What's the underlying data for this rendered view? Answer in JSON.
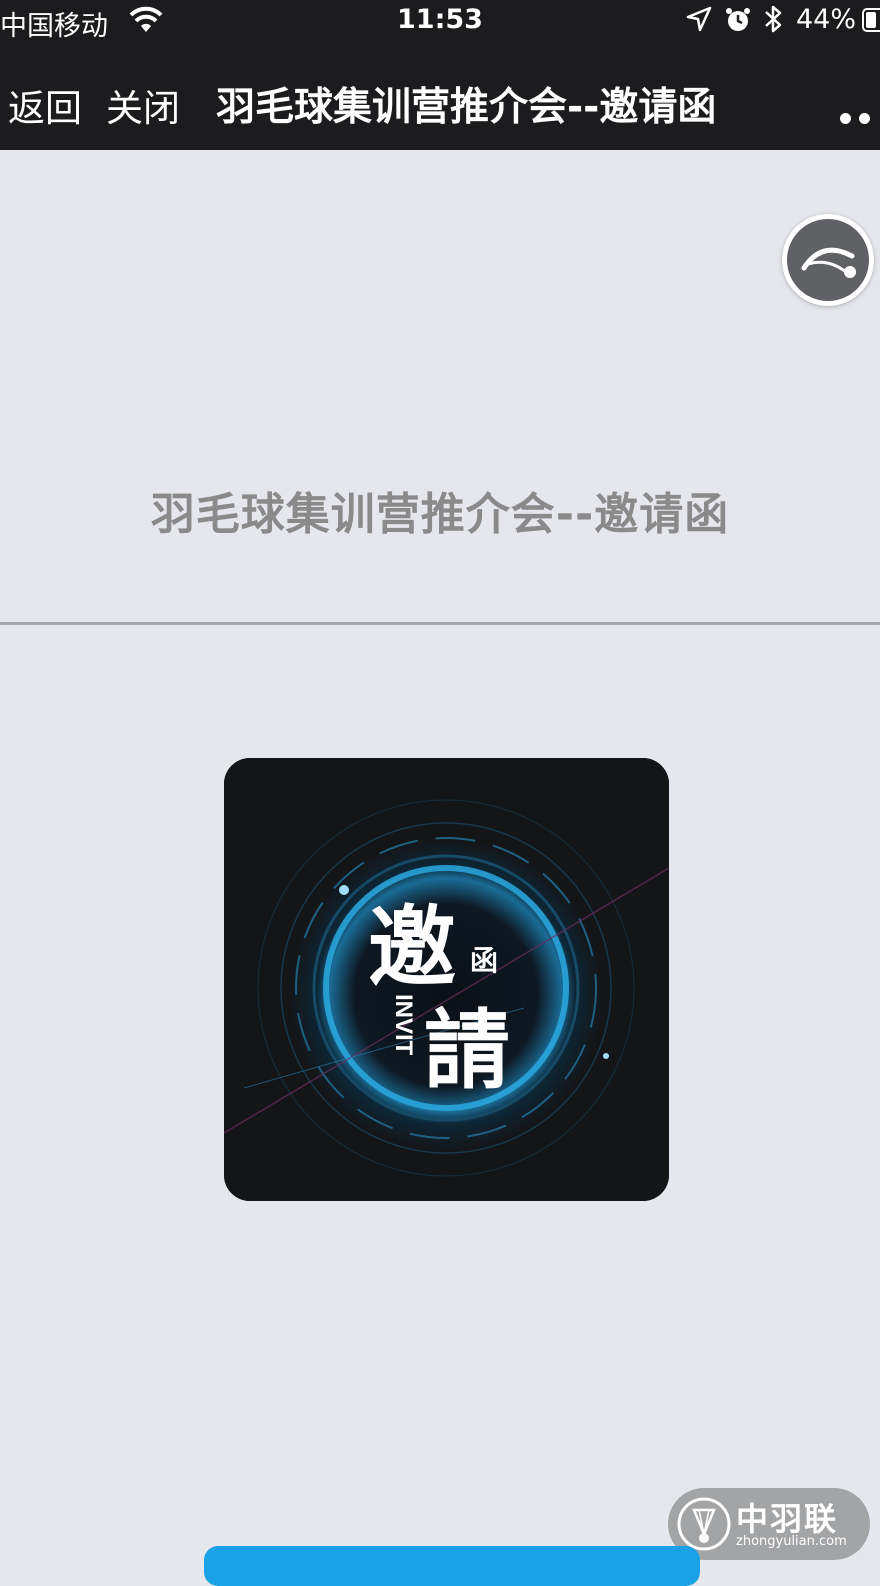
{
  "status_bar": {
    "carrier": "中国移动",
    "time": "11:53",
    "battery_percent": "44%",
    "battery_level": 0.44,
    "icons": [
      "wifi-icon",
      "location-arrow-icon",
      "alarm-icon",
      "bluetooth-icon",
      "battery-icon"
    ]
  },
  "nav": {
    "back_label": "返回",
    "close_label": "关闭",
    "title": "羽毛球集训营推介会--邀请函",
    "more_icon": "more-dots-icon"
  },
  "page": {
    "heading": "羽毛球集训营推介会--邀请函",
    "music_icon": "music-player-icon",
    "invite_image": {
      "char_big_1": "邀",
      "char_small": "函",
      "char_big_2": "請",
      "vertical_text": "INVIT"
    }
  },
  "watermark": {
    "name_cn": "中羽联",
    "name_en": "zhongyulian.com"
  },
  "colors": {
    "topbar_bg": "#1c1c1e",
    "page_bg": "#e5e7ec",
    "heading_text": "#8a8a8a",
    "accent_blue": "#1aa1e6"
  }
}
